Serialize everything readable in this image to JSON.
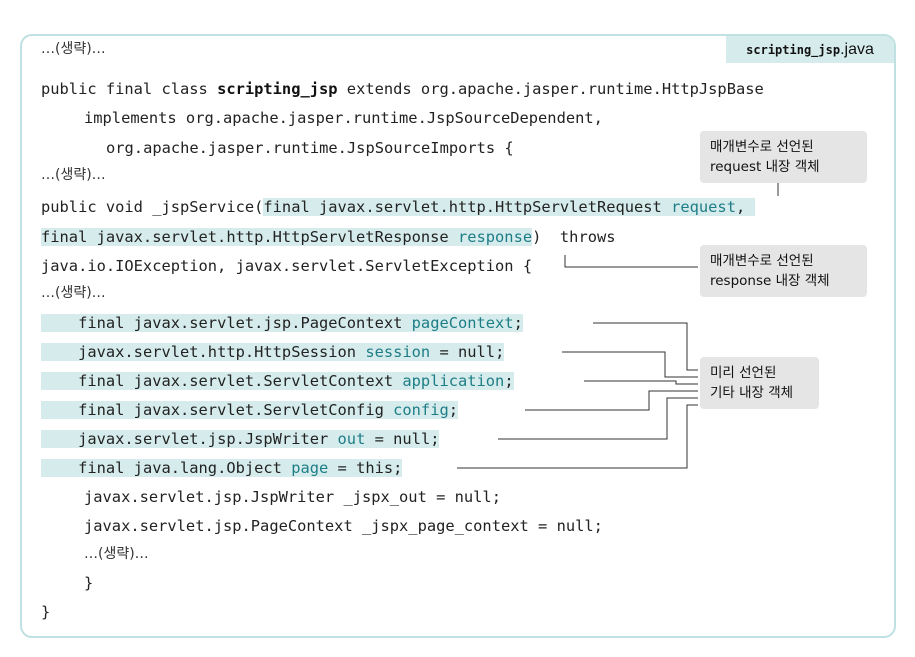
{
  "file_tab": {
    "name_mono": "scripting_jsp",
    "extension": ".java"
  },
  "code": {
    "l1": "…(생략)…",
    "l2": {
      "a": "public final class ",
      "b": "scripting_jsp",
      "c": " extends org.apache.jasper.runtime.HttpJspBase"
    },
    "l3": "implements org.apache.jasper.runtime.JspSourceDependent,",
    "l4": "org.apache.jasper.runtime.JspSourceImports {",
    "l5": "…(생략)…",
    "l6": {
      "a": "public void _jspService(",
      "b": "final javax.servlet.http.HttpServletRequest ",
      "c": "request",
      "d": ","
    },
    "l7": {
      "a": "final javax.servlet.http.HttpServletResponse ",
      "b": "response",
      "c": ")  throws"
    },
    "l8": "java.io.IOException, javax.servlet.ServletException {",
    "l9": "…(생략)…",
    "l10": {
      "a": "final javax.servlet.jsp.PageContext ",
      "b": "pageContext",
      "c": ";"
    },
    "l11": {
      "a": "javax.servlet.http.HttpSession ",
      "b": "session",
      "c": " = null;"
    },
    "l12": {
      "a": "final javax.servlet.ServletContext ",
      "b": "application",
      "c": ";"
    },
    "l13": {
      "a": "final javax.servlet.ServletConfig ",
      "b": "config",
      "c": ";"
    },
    "l14": {
      "a": "javax.servlet.jsp.JspWriter ",
      "b": "out",
      "c": " = null;"
    },
    "l15": {
      "a": "final java.lang.Object ",
      "b": "page",
      "c": " = this;"
    },
    "l16": "javax.servlet.jsp.JspWriter _jspx_out = null;",
    "l17": "javax.servlet.jsp.PageContext _jspx_page_context = null;",
    "l18": "…(생략)…",
    "l19": "}",
    "l20": "}"
  },
  "callouts": {
    "request": {
      "line1": "매개변수로 선언된",
      "line2": "request 내장 객체"
    },
    "response": {
      "line1": "매개변수로 선언된",
      "line2": "response 내장 객체"
    },
    "others": {
      "line1": "미리 선언된",
      "line2": "기타 내장 객체"
    }
  }
}
